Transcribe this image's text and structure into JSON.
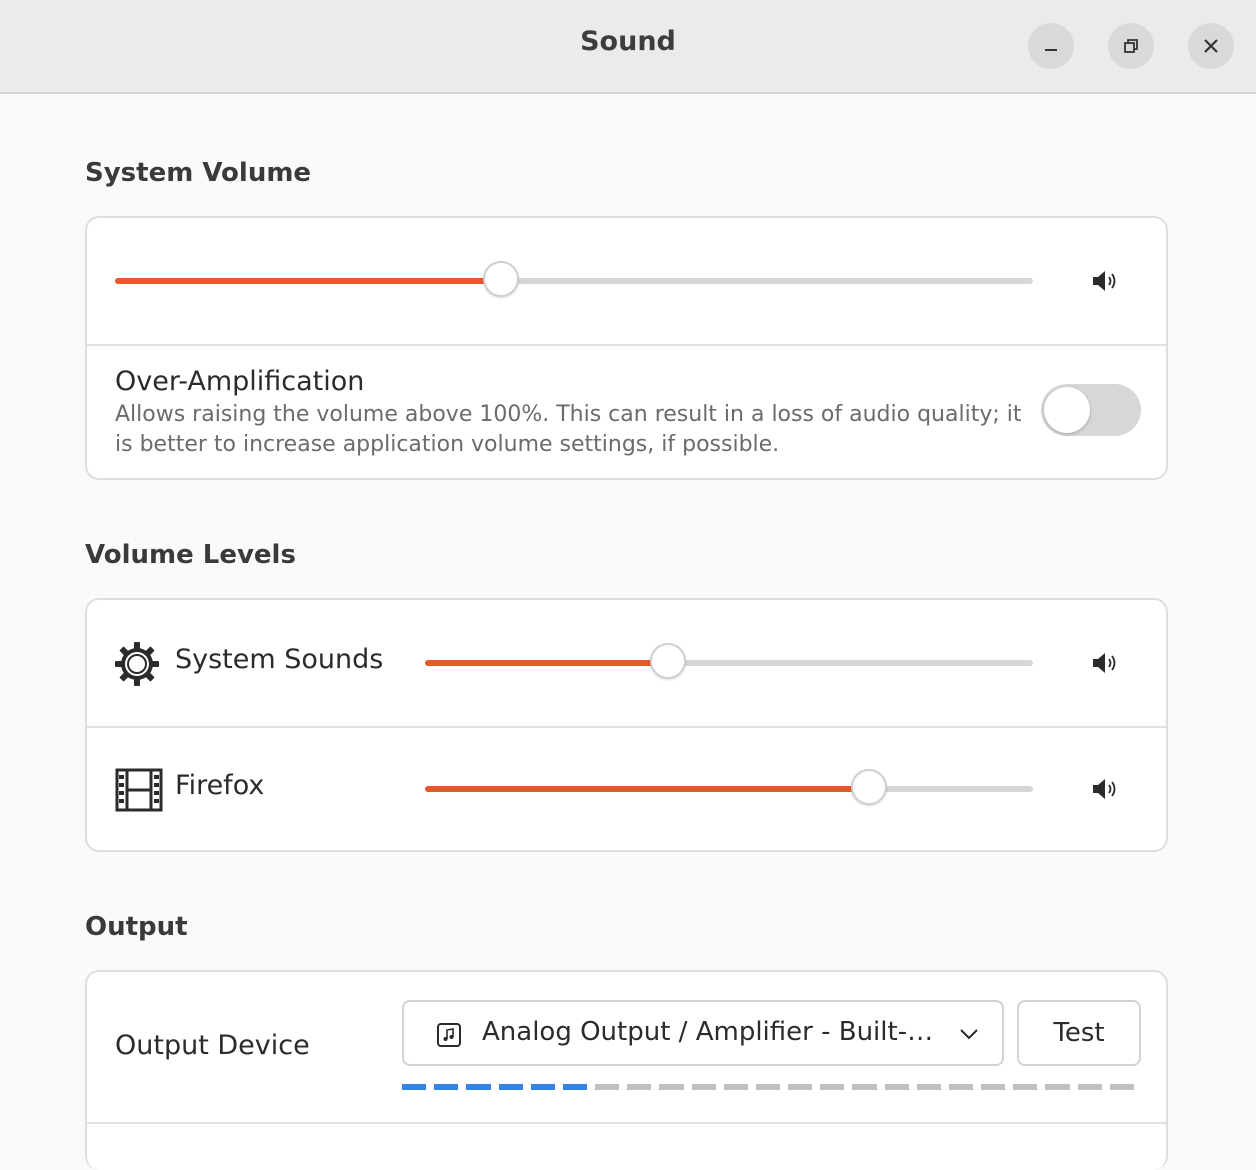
{
  "window": {
    "title": "Sound",
    "controls": {
      "minimize": "minimize-icon",
      "maximize": "restore-icon",
      "close": "close-icon"
    }
  },
  "system_volume": {
    "heading": "System Volume",
    "level": 0.42,
    "over_amplification": {
      "label": "Over-Amplification",
      "description_line1": "Allows raising the volume above 100%. This can result in a loss of audio quality; it",
      "description_line2": "is better to increase application volume settings, if possible.",
      "enabled": false
    }
  },
  "volume_levels": {
    "heading": "Volume Levels",
    "apps": [
      {
        "label": "System Sounds",
        "icon": "gear-icon",
        "level": 0.4
      },
      {
        "label": "Firefox",
        "icon": "film-icon",
        "level": 0.73
      }
    ]
  },
  "output": {
    "heading": "Output",
    "device_label": "Output Device",
    "device_value": "Analog Output / Amplifier - Built-…",
    "test_label": "Test",
    "meter_segments_total": 23,
    "meter_segments_active": 6
  },
  "colors": {
    "accent": "#e9572b",
    "meter_active": "#3584e4",
    "meter_inactive": "#c0c0c0"
  }
}
